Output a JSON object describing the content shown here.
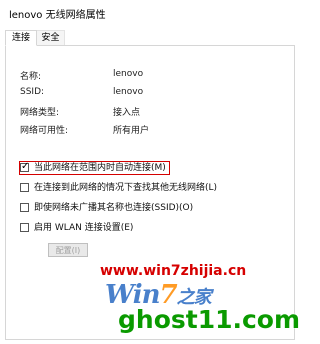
{
  "window": {
    "title": "lenovo 无线网络属性"
  },
  "tabs": [
    {
      "label": "连接",
      "active": true
    },
    {
      "label": "安全",
      "active": false
    }
  ],
  "properties": [
    {
      "label": "名称:",
      "value": "lenovo"
    },
    {
      "label": "SSID:",
      "value": "lenovo"
    },
    {
      "label": "网络类型:",
      "value": "接入点"
    },
    {
      "label": "网络可用性:",
      "value": "所有用户"
    }
  ],
  "options": [
    {
      "label": "当此网络在范围内时自动连接(M)",
      "checked": true,
      "highlighted": true
    },
    {
      "label": "在连接到此网络的情况下查找其他无线网络(L)",
      "checked": false
    },
    {
      "label": "即使网络未广播其名称也连接(SSID)(O)",
      "checked": false
    },
    {
      "label": "启用 WLAN 连接设置(E)",
      "checked": false
    }
  ],
  "configure_button": {
    "label": "配置(I)",
    "enabled": false
  },
  "watermark": {
    "url": "www.win7zhijia.cn",
    "logo_main": "Win",
    "logo_seven": "7",
    "logo_tail": "之家",
    "site": "ghost11.com"
  },
  "colors": {
    "highlight": "#d40000",
    "watermark_url": "#d60000",
    "watermark_site": "#0a9a00",
    "logo": "#2a6bc2"
  }
}
